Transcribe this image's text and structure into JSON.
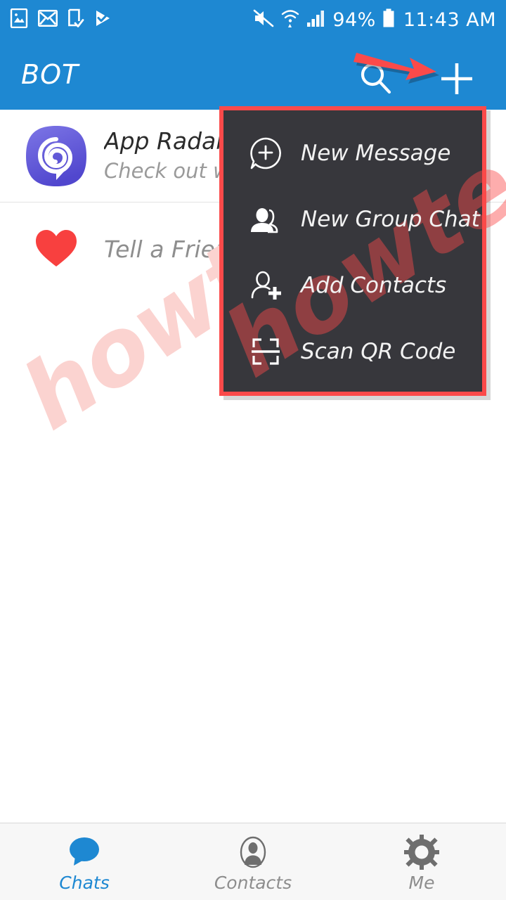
{
  "colors": {
    "accent": "#1e88d2",
    "menu_bg": "#37373c",
    "annotation_red": "#fb4a4a",
    "heart_red": "#f8403f",
    "app_radar_purple": "#5b4fd4",
    "watermark_pink": "#fbd3d0"
  },
  "status_bar": {
    "left_icons": [
      {
        "name": "gallery-icon",
        "label": "gallery"
      },
      {
        "name": "email-icon",
        "label": "email"
      },
      {
        "name": "download-complete-icon",
        "label": "download complete"
      },
      {
        "name": "play-store-icon",
        "label": "play store"
      }
    ],
    "right_icons": [
      {
        "name": "mute-icon",
        "label": "sound muted"
      },
      {
        "name": "wifi-icon",
        "label": "wifi connected"
      },
      {
        "name": "signal-icon",
        "label": "cellular signal"
      }
    ],
    "battery_percent": "94%",
    "time": "11:43 AM"
  },
  "app_bar": {
    "title": "BOT",
    "search_icon": "search-icon",
    "add_icon": "plus-icon"
  },
  "chat_list": [
    {
      "avatar": "app-radar-spiral-icon",
      "title": "App Radar",
      "subtitle": "Check out wh"
    },
    {
      "avatar": "heart-icon",
      "title": "Tell a Friend",
      "subtitle": ""
    }
  ],
  "dropdown_menu": {
    "items": [
      {
        "icon": "new-message-icon",
        "label": "New Message"
      },
      {
        "icon": "new-group-chat-icon",
        "label": "New Group Chat"
      },
      {
        "icon": "add-contacts-icon",
        "label": "Add Contacts"
      },
      {
        "icon": "scan-qr-code-icon",
        "label": "Scan QR Code"
      }
    ]
  },
  "bottom_nav": {
    "items": [
      {
        "icon": "chats-bubble-icon",
        "label": "Chats",
        "active": true
      },
      {
        "icon": "contacts-person-icon",
        "label": "Contacts",
        "active": false
      },
      {
        "icon": "me-gear-icon",
        "label": "Me",
        "active": false
      }
    ]
  },
  "watermark": {
    "text": "howtech"
  }
}
